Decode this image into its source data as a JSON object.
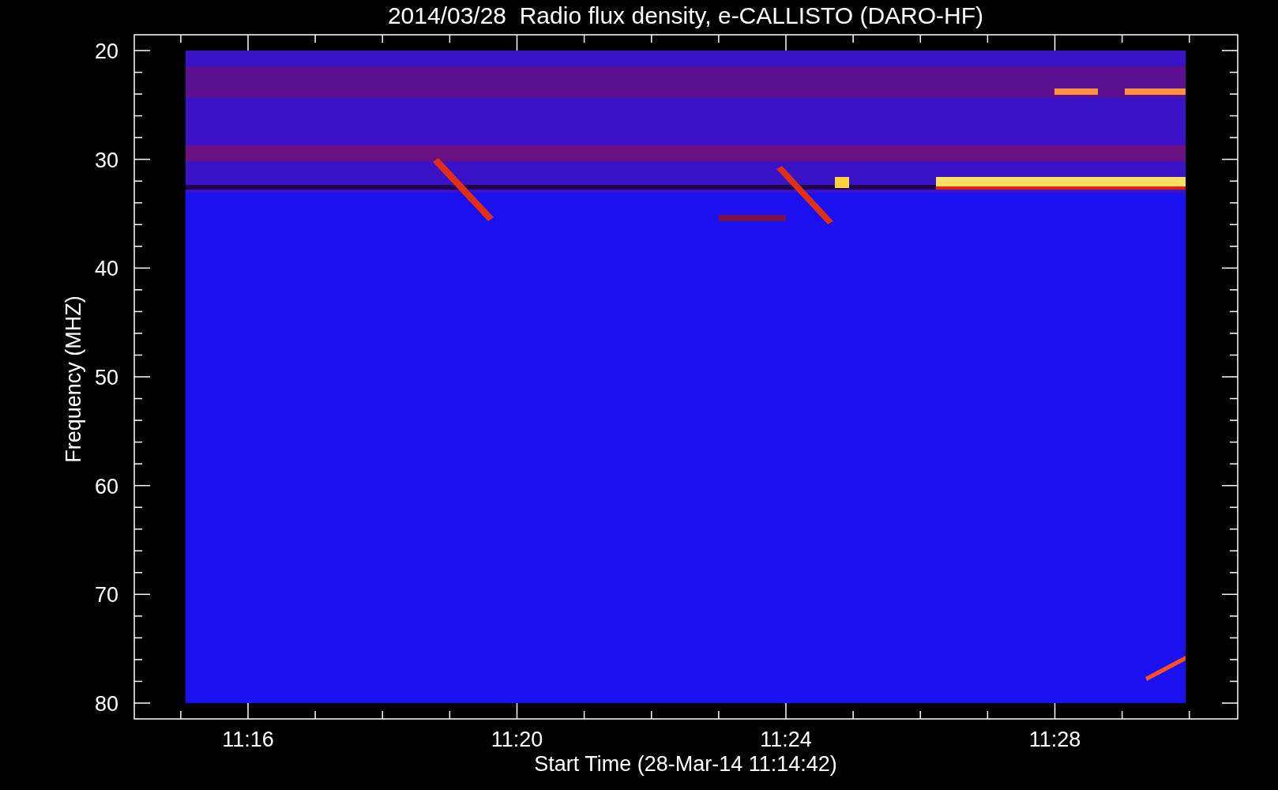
{
  "title": "2014/03/28  Radio flux density, e-CALLISTO (DARO-HF)",
  "y_axis": {
    "label": "Frequency (MHZ)",
    "ticks": [
      "20",
      "30",
      "40",
      "50",
      "60",
      "70",
      "80"
    ]
  },
  "x_axis": {
    "label": "Start Time (28-Mar-14 11:14:42)",
    "ticks": [
      "11:16",
      "11:20",
      "11:24",
      "11:28"
    ]
  }
}
